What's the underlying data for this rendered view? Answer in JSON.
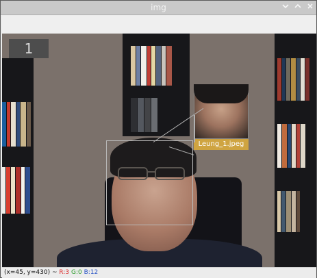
{
  "window": {
    "title": "img"
  },
  "titlebar": {
    "minimize_icon": "chevron-down-icon",
    "maximize_icon": "chevron-up-icon",
    "close_icon": "close-icon"
  },
  "canvas": {
    "frame_number": "1",
    "gallery_label": "Leung_1.jpeg",
    "gallery_label_color": "#cfa441"
  },
  "status": {
    "prefix": "(x=45, y=430) ~",
    "r": "R:3",
    "g": "G:0",
    "b": "B:12"
  }
}
